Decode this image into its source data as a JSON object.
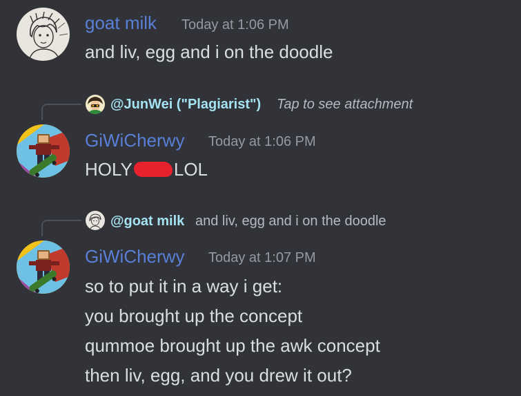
{
  "colors": {
    "background": "#313338",
    "goat_milk_name": "#5a7fd6",
    "giwicherwy_name": "#5a7fd6",
    "junwei_mention": "#a5e3f2",
    "goat_mention": "#a5e3f2",
    "timestamp": "#949ba4",
    "message_text": "#dbdee1",
    "redaction": "#e8222c"
  },
  "messages": [
    {
      "avatar_icon": "sketch-portrait-avatar-icon",
      "username": "goat milk",
      "timestamp": "Today at 1:06 PM",
      "lines": [
        "and liv, egg and i on the doodle"
      ]
    },
    {
      "reply": {
        "avatar_icon": "character-avatar-icon",
        "mention": "@JunWei (\"Plagiarist\")",
        "preview": "Tap to see attachment"
      },
      "avatar_icon": "roblox-skateboard-avatar-icon",
      "username": "GiWiCherwy",
      "timestamp": "Today at 1:06 PM",
      "text_before": "HOLY",
      "text_after": "LOL"
    },
    {
      "reply": {
        "avatar_icon": "sketch-portrait-avatar-icon",
        "mention": "@goat milk",
        "preview": "and liv, egg and i on the doodle"
      },
      "avatar_icon": "roblox-skateboard-avatar-icon",
      "username": "GiWiCherwy",
      "timestamp": "Today at 1:07 PM",
      "lines": [
        "so to put it in a way i get:",
        "you brought up the concept",
        "qummoe brought up the awk concept",
        "then liv, egg, and you drew it out?"
      ]
    }
  ]
}
